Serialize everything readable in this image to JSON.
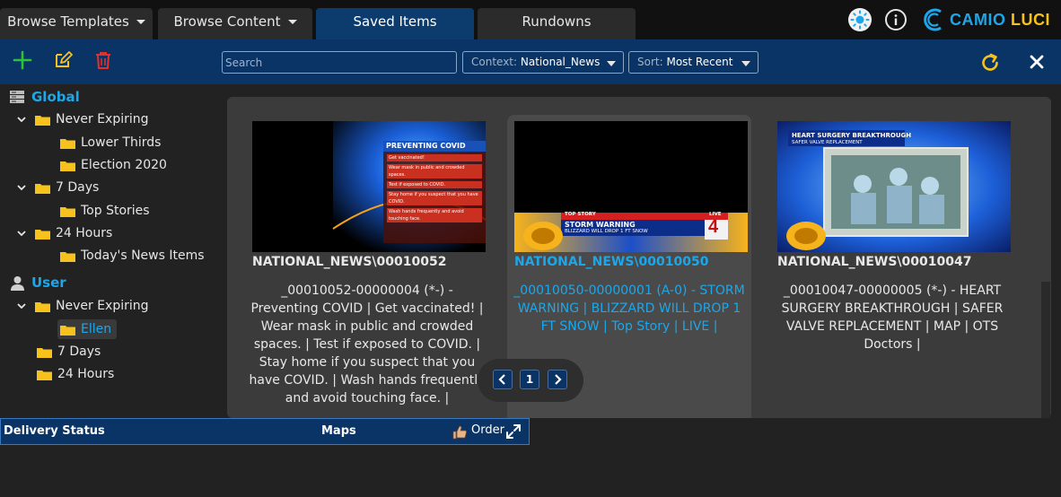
{
  "tabs": [
    {
      "label": "Browse Templates",
      "has_dropdown": true,
      "active": false
    },
    {
      "label": "Browse Content",
      "has_dropdown": true,
      "active": false
    },
    {
      "label": "Saved Items",
      "has_dropdown": false,
      "active": true
    },
    {
      "label": "Rundowns",
      "has_dropdown": false,
      "active": false
    }
  ],
  "brand": {
    "name_part1": "CAMIO",
    "name_part2": "LUCI",
    "color_primary": "#1da7ea",
    "color_secondary": "#f7c21b"
  },
  "header_icons": [
    "brightness-icon",
    "info-icon"
  ],
  "toolbar": {
    "add_icon": "plus-icon",
    "edit_icon": "edit-icon",
    "delete_icon": "trash-icon",
    "search_placeholder": "Search",
    "context_label": "Context:",
    "context_value": "National_News",
    "sort_label": "Sort:",
    "sort_value": "Most Recent",
    "refresh_icon": "refresh-icon",
    "close_icon": "close-icon"
  },
  "sidebar": {
    "global": {
      "label": "Global",
      "children": [
        {
          "label": "Never Expiring",
          "children": [
            "Lower Thirds",
            "Election 2020"
          ]
        },
        {
          "label": "7 Days",
          "children": [
            "Top Stories"
          ]
        },
        {
          "label": "24 Hours",
          "children": [
            "Today's News Items"
          ]
        }
      ]
    },
    "user": {
      "label": "User",
      "children": [
        {
          "label": "Never Expiring",
          "children": [
            "Ellen"
          ]
        },
        {
          "label": "7 Days",
          "children": []
        },
        {
          "label": "24 Hours",
          "children": []
        }
      ],
      "selected": "Ellen"
    }
  },
  "items": [
    {
      "title": "NATIONAL_NEWS\\00010052",
      "description": "_00010052-00000004 (*-) - Preventing COVID | Get vaccinated! | Wear mask in public and crowded spaces. | Test if exposed to COVID. | Stay home if you suspect that you have COVID. | Wash hands frequently and avoid touching face. |",
      "thumb": {
        "heading": "PREVENTING COVID",
        "bullets": [
          "Get vaccinated!",
          "Wear mask in public and crowded spaces.",
          "Test if exposed to COVID.",
          "Stay home if you suspect that you have COVID.",
          "Wash hands frequently and avoid touching face."
        ]
      },
      "highlighted": false
    },
    {
      "title": "NATIONAL_NEWS\\00010050",
      "description": "_00010050-00000001 (A-0) - STORM WARNING | BLIZZARD WILL DROP 1 FT SNOW | Top Story | LIVE |",
      "thumb": {
        "tag": "TOP STORY",
        "headline": "STORM WARNING",
        "subline": "BLIZZARD WILL DROP 1 FT SNOW",
        "live": "LIVE",
        "channel": "4"
      },
      "highlighted": true
    },
    {
      "title": "NATIONAL_NEWS\\00010047",
      "description": "_00010047-00000005 (*-) - HEART SURGERY BREAKTHROUGH | SAFER VALVE REPLACEMENT | MAP | OTS Doctors |",
      "thumb": {
        "headline": "HEART SURGERY BREAKTHROUGH",
        "subline": "SAFER VALVE REPLACEMENT"
      },
      "highlighted": false
    }
  ],
  "pagination": {
    "current_page": "1"
  },
  "bottom_bar": {
    "delivery_status": "Delivery Status",
    "maps": "Maps",
    "order": "Order"
  }
}
